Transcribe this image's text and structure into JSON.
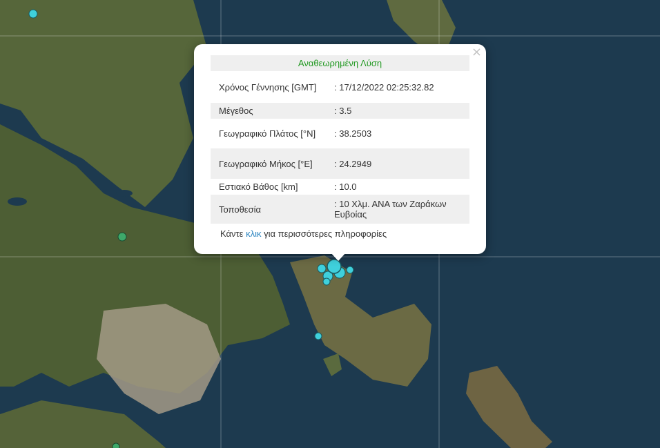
{
  "popup": {
    "close_label": "×",
    "header": "Αναθεωρημένη Λύση",
    "rows": [
      {
        "label": "Χρόνος Γέννησης [GMT]",
        "value": ": 17/12/2022 02:25:32.82"
      },
      {
        "label": "Μέγεθος",
        "value": ": 3.5"
      },
      {
        "label": "Γεωγραφικό Πλάτος [°N]",
        "value": ": 38.2503"
      },
      {
        "label": "Γεωγραφικό Μήκος [°E]",
        "value": ": 24.2949"
      },
      {
        "label": "Εστιακό Βάθος [km]",
        "value": ": 10.0"
      },
      {
        "label": "Τοποθεσία",
        "value": ": 10 Χλμ. ΑΝΑ των Ζαράκων Ευβοίας"
      }
    ],
    "click_prefix": "Κάντε",
    "click_link": "κλικ",
    "click_suffix": "για περισσότερες πληροφορίες"
  },
  "colors": {
    "sea": "#1d3a4f",
    "land": "#5a6b3c",
    "urban": "#a59b86",
    "quake_cyan": "#3fd0dc",
    "quake_green": "#3ea96a",
    "header_green": "#229922",
    "link_blue": "#2a84c0"
  }
}
